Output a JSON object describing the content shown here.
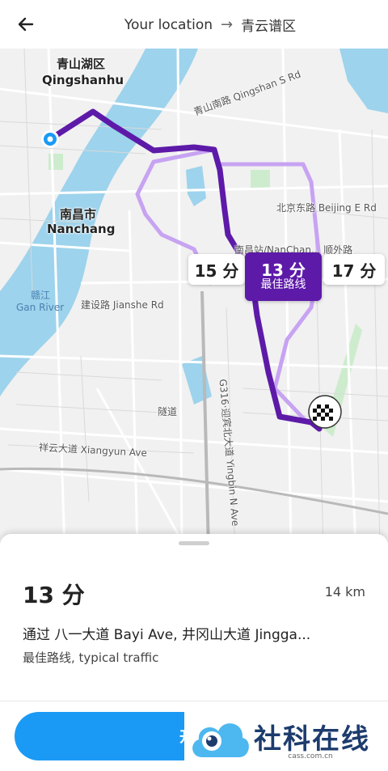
{
  "header": {
    "origin": "Your location",
    "destination": "青云谱区"
  },
  "map": {
    "labels": {
      "qingshanhu_cn": "青山湖区",
      "qingshanhu_en": "Qingshanhu",
      "nanchang_cn": "南昌市",
      "nanchang_en": "Nanchang",
      "ganjiang_cn": "赣江",
      "ganriver_en": "Gan River",
      "qingshan_s_rd": "青山南路 Qingshan S Rd",
      "beijing_e_rd": "北京东路 Beijing E Rd",
      "jianshe_rd": "建设路 Jianshe Rd",
      "xiangyun_ave": "祥云大道 Xiangyun Ave",
      "yingbin_n_ave": "G316·迎宾北大道 Yingbin N Ave",
      "tunnel": "隧道",
      "station": "南昌站/NanChan... 顺外路"
    },
    "routes": [
      {
        "eta": "15 分",
        "best": false
      },
      {
        "eta": "13 分",
        "subtitle": "最佳路线",
        "best": true
      },
      {
        "eta": "17 分",
        "best": false
      }
    ],
    "colors": {
      "best_route": "#5d1aa8",
      "alt_route": "#c7a3f2",
      "water": "#9dd3ec",
      "park": "#cdeccd"
    }
  },
  "sheet": {
    "eta": "13 分",
    "distance": "14 km",
    "via": "通过 八一大道 Bayi Ave, 井冈山大道 Jingga...",
    "traffic": "最佳路线, typical traffic",
    "start_label": "开始",
    "start_color": "#1a9af5"
  },
  "watermark": {
    "brand": "社科在线",
    "site": "cass.com.cn"
  }
}
